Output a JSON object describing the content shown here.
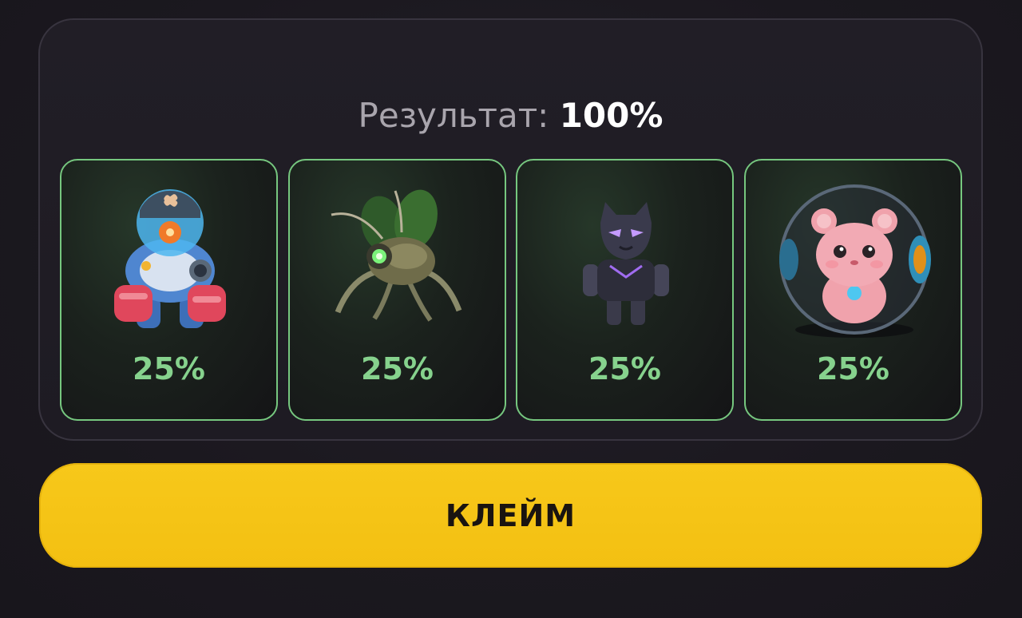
{
  "result": {
    "label": "Результат:",
    "value": "100%"
  },
  "cards": [
    {
      "icon": "robot-fish-icon",
      "percent": "25%"
    },
    {
      "icon": "mech-bug-icon",
      "percent": "25%"
    },
    {
      "icon": "panther-warrior-icon",
      "percent": "25%"
    },
    {
      "icon": "hamster-ball-icon",
      "percent": "25%"
    }
  ],
  "claim_button": {
    "label": "КЛЕЙМ"
  },
  "colors": {
    "accent_green": "#86d28d",
    "card_border": "#76c77f",
    "button_yellow": "#f7c81a",
    "background": "#1c1920"
  }
}
